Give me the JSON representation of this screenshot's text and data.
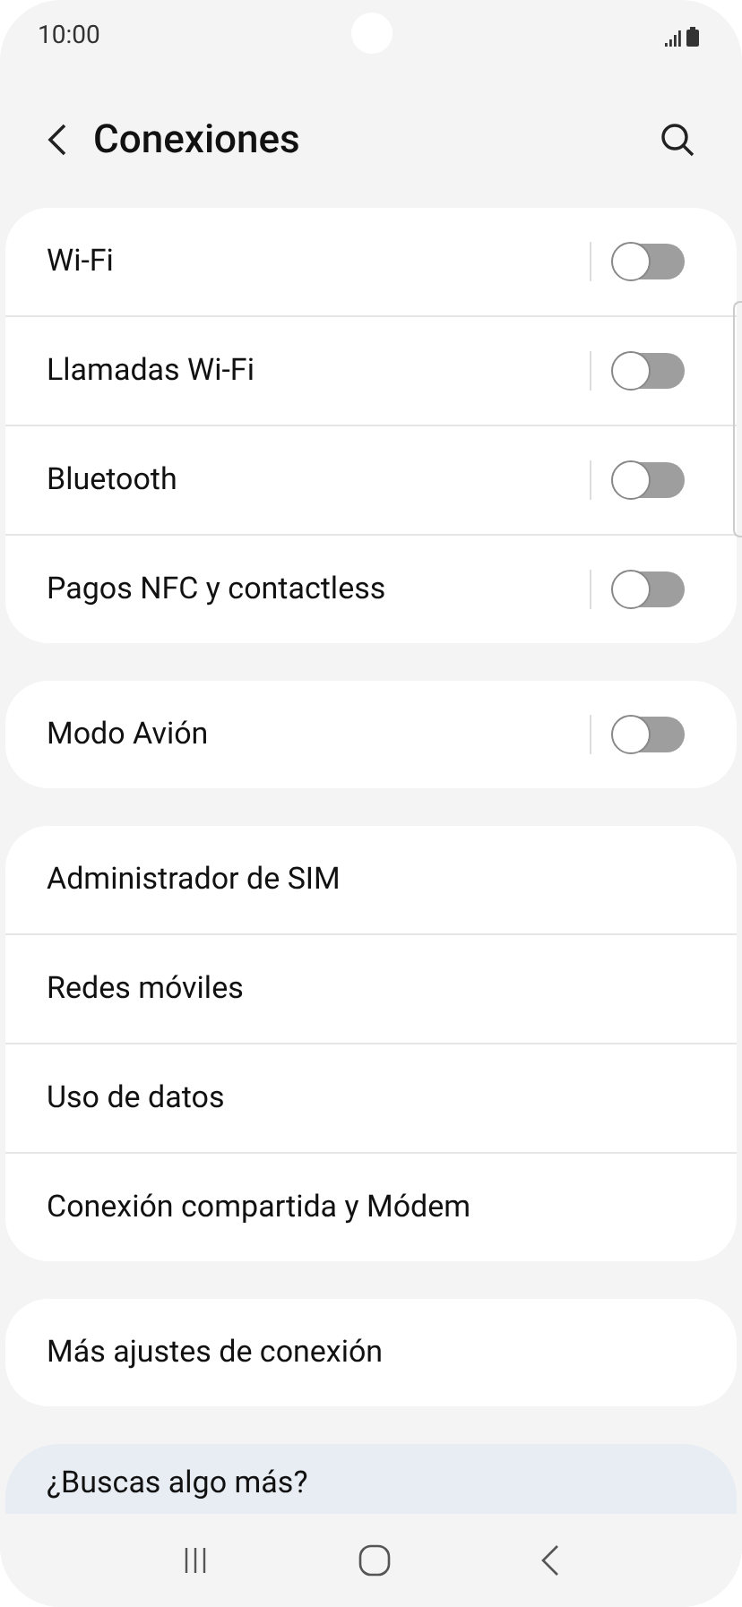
{
  "status_bar": {
    "time": "10:00"
  },
  "header": {
    "title": "Conexiones"
  },
  "groups": [
    {
      "items": [
        {
          "label": "Wi-Fi",
          "kind": "toggle",
          "on": false
        },
        {
          "label": "Llamadas Wi-Fi",
          "kind": "toggle",
          "on": false
        },
        {
          "label": "Bluetooth",
          "kind": "toggle",
          "on": false
        },
        {
          "label": "Pagos NFC y contactless",
          "kind": "toggle",
          "on": false
        }
      ]
    },
    {
      "items": [
        {
          "label": "Modo Avión",
          "kind": "toggle",
          "on": false
        }
      ]
    },
    {
      "items": [
        {
          "label": "Administrador de SIM",
          "kind": "link"
        },
        {
          "label": "Redes móviles",
          "kind": "link"
        },
        {
          "label": "Uso de datos",
          "kind": "link"
        },
        {
          "label": "Conexión compartida y Módem",
          "kind": "link"
        }
      ]
    },
    {
      "items": [
        {
          "label": "Más ajustes de conexión",
          "kind": "link"
        }
      ]
    }
  ],
  "suggestion": {
    "title": "¿Buscas algo más?"
  }
}
